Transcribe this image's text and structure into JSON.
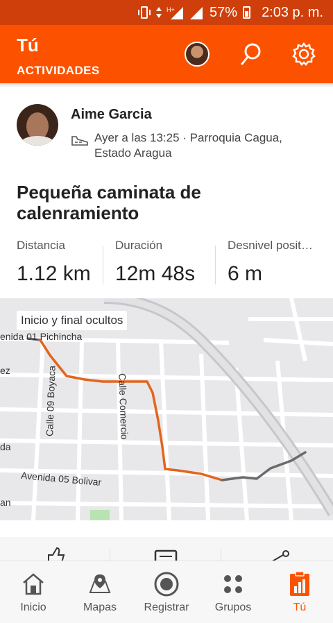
{
  "status_bar": {
    "battery": "57%",
    "time": "2:03 p. m."
  },
  "header": {
    "title": "Tú",
    "subtitle": "ACTIVIDADES",
    "icons": [
      "avatar",
      "search-icon",
      "gear-icon"
    ]
  },
  "activity": {
    "athlete_name": "Aime Garcia",
    "meta": "Ayer a las 13:25 · Parroquia Cagua, Estado Aragua",
    "title": "Pequeña caminata de calenramiento",
    "stats": [
      {
        "label": "Distancia",
        "value": "1.12 km"
      },
      {
        "label": "Duración",
        "value": "12m 48s"
      },
      {
        "label": "Desnivel posit…",
        "value": "6 m"
      }
    ]
  },
  "map": {
    "privacy_chip": "Inicio y final ocultos",
    "streets": {
      "pichincha": "enida 01 Pichincha",
      "boyaca": "Calle 09 Boyaca",
      "comercio": "Calle Comercio",
      "bolivar": "Avenida 05 Bolivar",
      "left_ez": "ez",
      "left_da": "da",
      "left_an": "an"
    }
  },
  "bottom_nav": {
    "items": [
      {
        "label": "Inicio",
        "icon": "home-icon"
      },
      {
        "label": "Mapas",
        "icon": "map-pin-icon"
      },
      {
        "label": "Registrar",
        "icon": "record-icon"
      },
      {
        "label": "Grupos",
        "icon": "groups-icon"
      },
      {
        "label": "Tú",
        "icon": "profile-stats-icon",
        "active": true
      }
    ]
  },
  "colors": {
    "brand": "#fc5200",
    "status_bar": "#cf3f0b",
    "route": "#e4641c",
    "hidden_route": "#666666"
  }
}
